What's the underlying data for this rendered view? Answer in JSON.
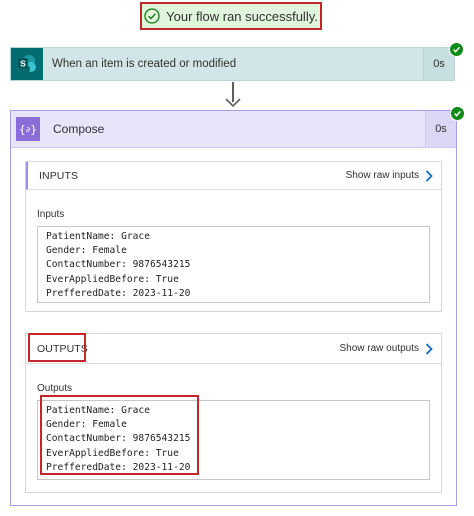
{
  "banner": {
    "text": "Your flow ran successfully."
  },
  "trigger": {
    "title": "When an item is created or modified",
    "duration": "0s"
  },
  "compose": {
    "title": "Compose",
    "duration": "0s",
    "inputs": {
      "section_label": "INPUTS",
      "raw_link": "Show raw inputs",
      "field_label": "Inputs",
      "lines": [
        "PatientName: Grace",
        "Gender: Female",
        "ContactNumber: 9876543215",
        "EverAppliedBefore: True",
        "PrefferedDate: 2023-11-20"
      ]
    },
    "outputs": {
      "section_label": "OUTPUTS",
      "raw_link": "Show raw outputs",
      "field_label": "Outputs",
      "lines": [
        "PatientName: Grace",
        "Gender: Female",
        "ContactNumber: 9876543215",
        "EverAppliedBefore: True",
        "PrefferedDate: 2023-11-20"
      ]
    }
  },
  "colors": {
    "success_bg": "#dff6dd",
    "highlight_border": "#c4262e",
    "sharepoint_teal": "#036c70",
    "compose_purple": "#8c6cd8",
    "link_blue": "#0f6cbd",
    "success_green": "#0e8a16"
  },
  "icons": {
    "banner": "check-circle-icon",
    "trigger": "sharepoint-icon",
    "compose": "compose-braces-icon",
    "raw_link": "chevron-right-icon",
    "status": "success-check-icon"
  }
}
